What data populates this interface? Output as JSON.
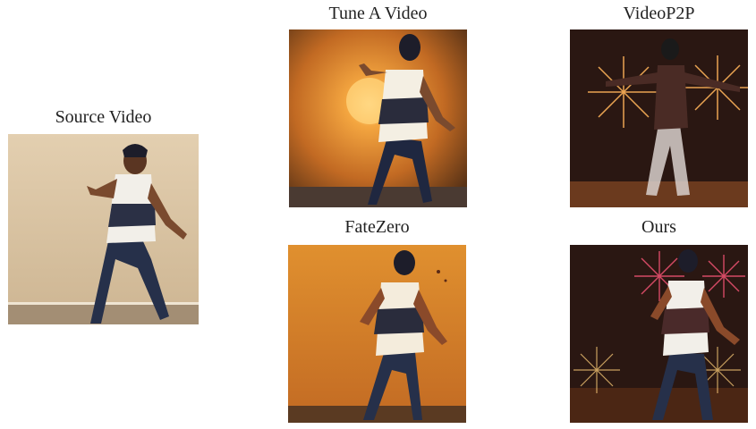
{
  "panels": {
    "source": {
      "caption": "Source Video"
    },
    "tune_a_video": {
      "caption": "Tune A Video"
    },
    "video_p2p": {
      "caption": "VideoP2P"
    },
    "fatezero": {
      "caption": "FateZero"
    },
    "ours": {
      "caption": "Ours"
    }
  },
  "colors": {
    "wall_beige": "#d9c3a2",
    "sunset_orange": "#e0902f",
    "night_sky": "#2a1712",
    "firework_pink": "#e8506e",
    "tights_navy": "#26304a"
  },
  "images": {
    "source": "photo of a man dancing in a sleeveless striped tank top in a beige room",
    "tune_a_video": "stylized dancer in front of a setting sun",
    "video_p2p": "dancer silhouette with fireworks",
    "fatezero": "illustrated dancer on an orange wall background",
    "ours": "dancer in striped tank top with fireworks background"
  }
}
